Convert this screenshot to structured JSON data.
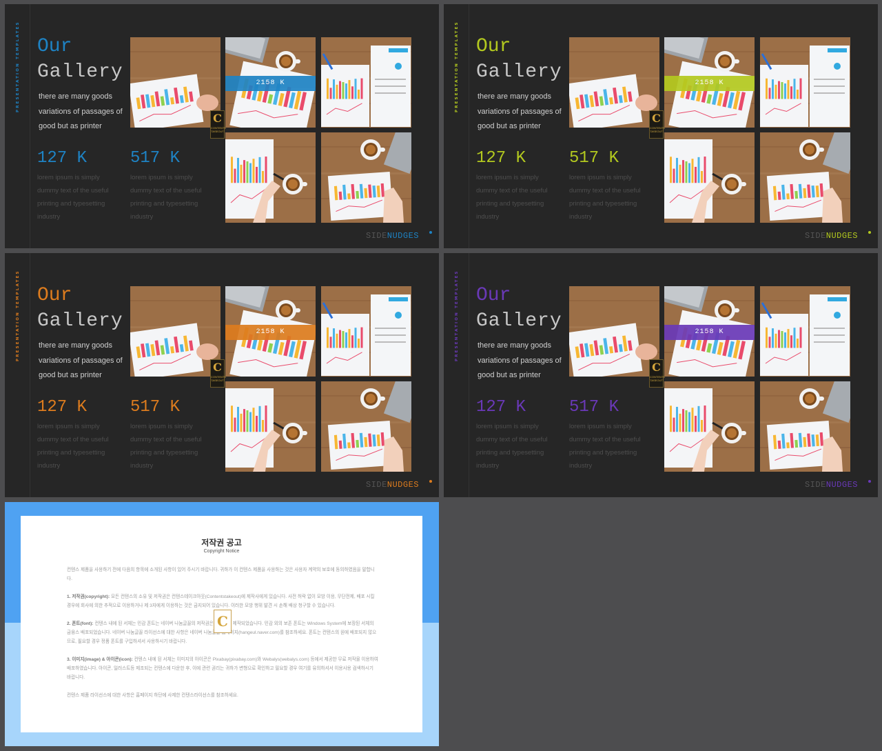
{
  "slides": [
    {
      "theme": "blue",
      "accent": "#1e83c4",
      "side_label": "PRESENTATION TEMPLATES",
      "title_line1": "Our",
      "title_line2": "Gallery",
      "description": "there are many goods variations of passages of good but as printer",
      "stat1": "127 K",
      "stat2": "517 K",
      "lorem1": "lorem ipsum is simply dummy text of the useful printing and typesetting industry",
      "lorem2": "lorem ipsum is simply dummy text of the useful printing and typesetting industry",
      "band_label": "2158 K",
      "badge_letter": "C",
      "badge_text": "CONTENTS TASEOUT",
      "brand_side": "SIDE",
      "brand_nudges": "NUDGES"
    },
    {
      "theme": "lime",
      "accent": "#b3c91f",
      "side_label": "PRESENTATION TEMPLATES",
      "title_line1": "Our",
      "title_line2": "Gallery",
      "description": "there are many goods variations of passages of good but as printer",
      "stat1": "127 K",
      "stat2": "517 K",
      "lorem1": "lorem ipsum is simply dummy text of the useful printing and typesetting industry",
      "lorem2": "lorem ipsum is simply dummy text of the useful printing and typesetting industry",
      "band_label": "2158 K",
      "badge_letter": "C",
      "badge_text": "CONTENTS TASEOUT",
      "brand_side": "SIDE",
      "brand_nudges": "NUDGES"
    },
    {
      "theme": "orange",
      "accent": "#dd7c1e",
      "side_label": "PRESENTATION TEMPLATES",
      "title_line1": "Our",
      "title_line2": "Gallery",
      "description": "there are many goods variations of passages of good but as printer",
      "stat1": "127 K",
      "stat2": "517 K",
      "lorem1": "lorem ipsum is simply dummy text of the useful printing and typesetting industry",
      "lorem2": "lorem ipsum is simply dummy text of the useful printing and typesetting industry",
      "band_label": "2158 K",
      "badge_letter": "C",
      "badge_text": "CONTENTS TASEOUT",
      "brand_side": "SIDE",
      "brand_nudges": "NUDGES"
    },
    {
      "theme": "purple",
      "accent": "#6a39b8",
      "side_label": "PRESENTATION TEMPLATES",
      "title_line1": "Our",
      "title_line2": "Gallery",
      "description": "there are many goods variations of passages of good but as printer",
      "stat1": "127 K",
      "stat2": "517 K",
      "lorem1": "lorem ipsum is simply dummy text of the useful printing and typesetting industry",
      "lorem2": "lorem ipsum is simply dummy text of the useful printing and typesetting industry",
      "band_label": "2158 K",
      "badge_letter": "C",
      "badge_text": "CONTENTS TASEOUT",
      "brand_side": "SIDE",
      "brand_nudges": "NUDGES"
    }
  ],
  "copyright": {
    "title": "저작권 공고",
    "subtitle": "Copyright Notice",
    "intro": "컨텐스 제품을 사용하기 전에 다음의 항목에 소개된 사항이 있어 주시기 바랍니다. 귀하가 이 컨텐스 제품을 사용하는 것은 사용자 계약의 보호에 동의하였음을 말합니다.",
    "item1_head": "1. 저작권(copyright):",
    "item1": " 모든 컨텐스의 소유 및 저작권은 컨텐스테이크아웃(Contentstakeout)에 제작사에게 있습니다. 사전 허락 없이 모방 이용, 무단전제, 배포 시킬 경우에 회사에 의한 추적으로 이용하거나 제 3자에게 이용하는 것은 금지되어 있습니다. 이러한 모방 행위 발견 시 손해 배상 청구할 수 있습니다.",
    "item2_head": "2. 폰트(font):",
    "item2": " 컨텐스 내에 된 서체는 민감 폰트는 네이버 나눔글꼴의 저작권은 네이버에 제작되었습니다. 민감 외의 보존 폰트는 Windows System에 보장된 서체의 금융스 배포되었습니다. 네이버 나눔글꼴 라이선스에 대한 사항은 네이버 나눔글꼴 홈페이지(hangeul.naver.com)를 참조하세요. 폰트는 컨텐스의 원에 배포되지 않으므로, 필요할 경우 정품 폰트를 구입하셔서 사용하시기 바랍니다.",
    "item3_head": "3. 이미지(image) & 아이콘(icon):",
    "item3": " 컨텐스 내에 된 서체는 이미지의 아이콘은 Pixabay(pixabay.com)와 Webalys(webalys.com) 등에서 제공한 무료 저작물 이용하여 배포하였습니다. 아이콘, 일러스트등 제조되는 컨텐스에 다운한 후, 이에 관련 권리는 귀하가 변형으로 확인하고 필요할 경우 여기를 유의하셔서 이용사용 검색하시기 바랍니다.",
    "outro": "컨텐스 제품 라이선스에 대한 사항은 홈페이지 하단에 사제한 컨텐스라이선스를 참조하세요.",
    "stamp_letter": "C"
  }
}
